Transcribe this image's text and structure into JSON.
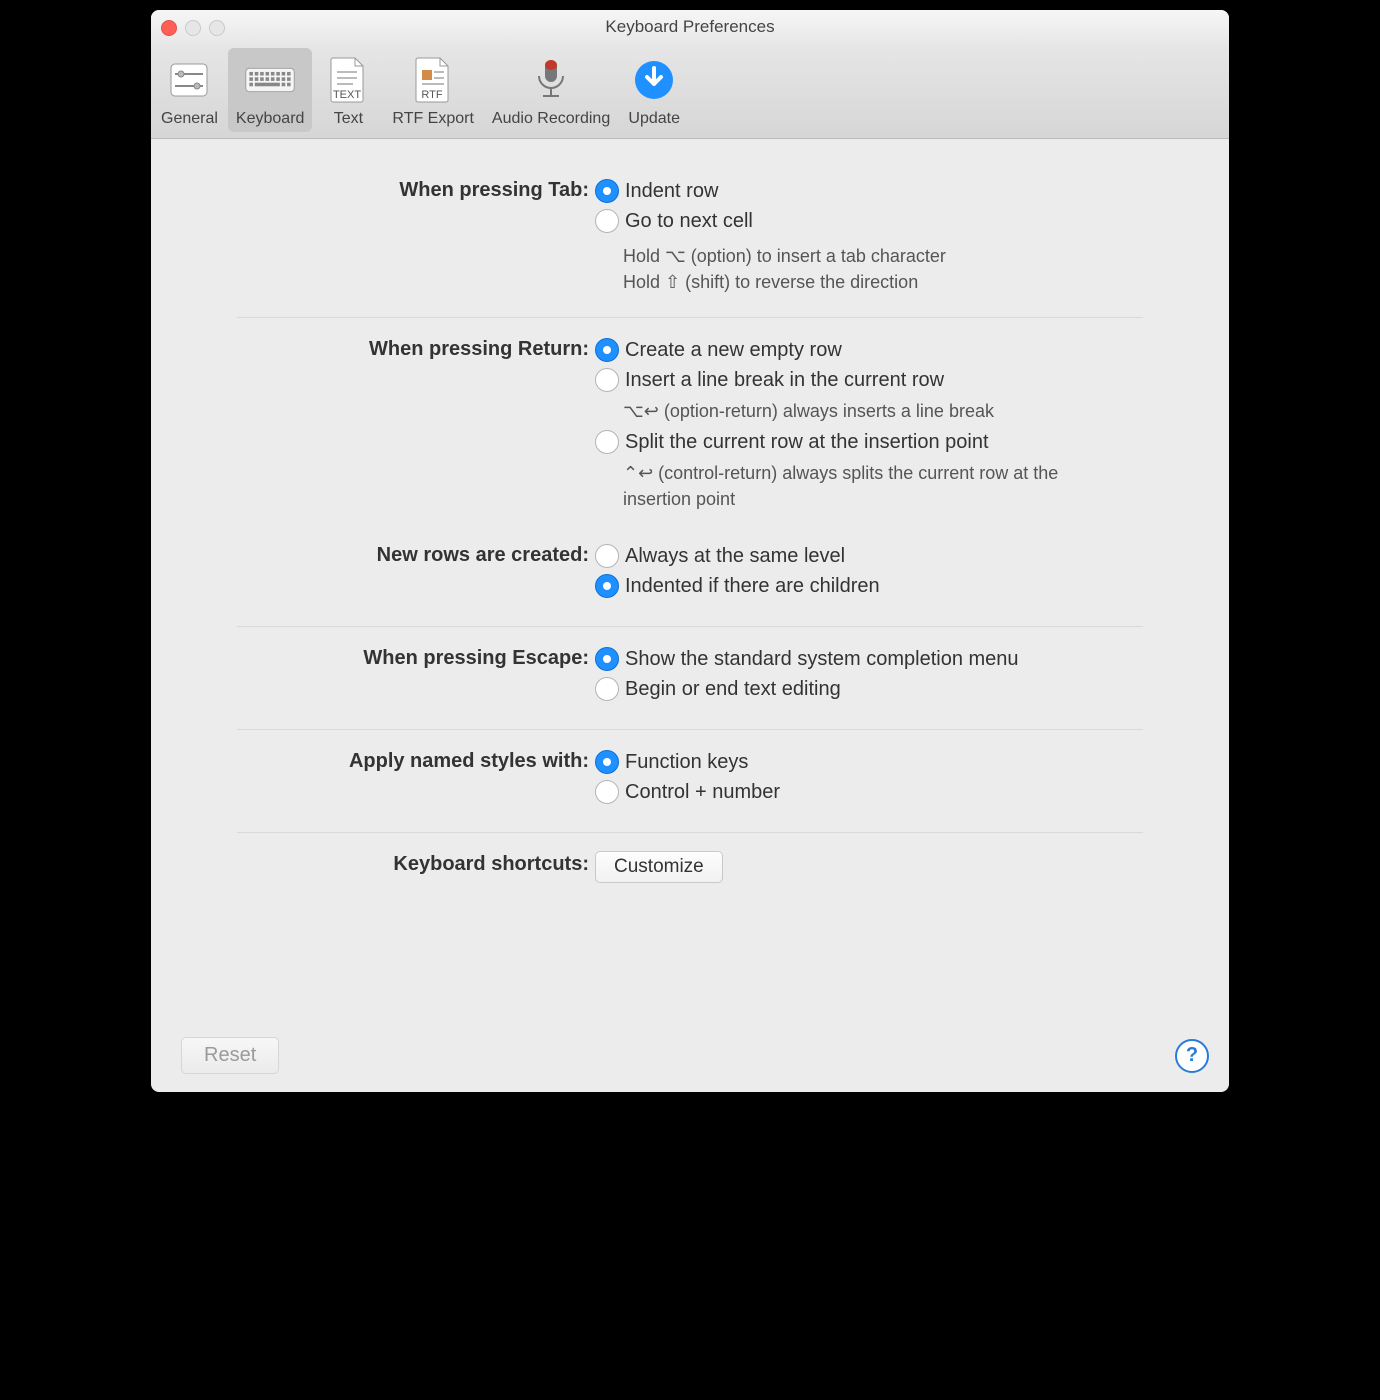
{
  "window_title": "Keyboard Preferences",
  "toolbar": {
    "items": [
      {
        "label": "General"
      },
      {
        "label": "Keyboard"
      },
      {
        "label": "Text"
      },
      {
        "label": "RTF Export"
      },
      {
        "label": "Audio Recording"
      },
      {
        "label": "Update"
      }
    ],
    "selected": "Keyboard"
  },
  "prefs": {
    "tab": {
      "label": "When pressing Tab:",
      "opt1": "Indent row",
      "opt2": "Go to next cell",
      "hint1": "Hold ⌥ (option) to insert a tab character",
      "hint2": "Hold ⇧ (shift) to reverse the direction",
      "selected": "opt1"
    },
    "return": {
      "label": "When pressing Return:",
      "opt1": "Create a new empty row",
      "opt2": "Insert a line break in the current row",
      "hint2": "⌥↩ (option-return) always inserts a line break",
      "opt3": "Split the current row at the insertion point",
      "hint3": "⌃↩ (control-return) always splits the current row at the insertion point",
      "selected": "opt1"
    },
    "newrows": {
      "label": "New rows are created:",
      "opt1": "Always at the same level",
      "opt2": "Indented if there are children",
      "selected": "opt2"
    },
    "escape": {
      "label": "When pressing Escape:",
      "opt1": "Show the standard system completion menu",
      "opt2": "Begin or end text editing",
      "selected": "opt1"
    },
    "styles": {
      "label": "Apply named styles with:",
      "opt1": "Function keys",
      "opt2": "Control + number",
      "selected": "opt1"
    },
    "shortcuts": {
      "label": "Keyboard shortcuts:",
      "button": "Customize"
    }
  },
  "footer": {
    "reset": "Reset",
    "help": "?"
  },
  "icons": {
    "general": "sliders-icon",
    "keyboard": "keyboard-icon",
    "text": "text-file-icon",
    "rtf": "rtf-file-icon",
    "audio": "microphone-icon",
    "update": "download-arrow-icon"
  }
}
